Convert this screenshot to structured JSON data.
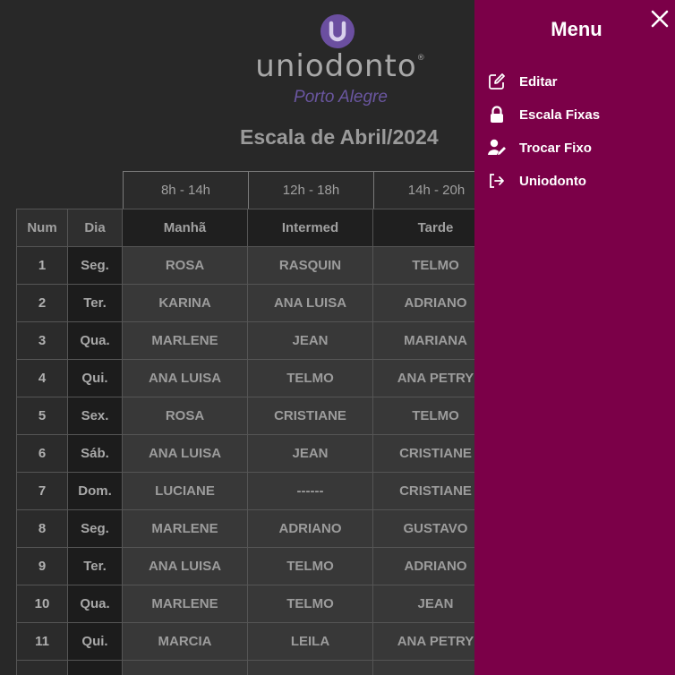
{
  "logo": {
    "wordmark": "uniodonto",
    "registered": "®",
    "subtitle": "Porto Alegre"
  },
  "title": "Escala de Abril/2024",
  "table": {
    "time_slots": [
      "8h - 14h",
      "12h - 18h",
      "14h - 20h"
    ],
    "headers": [
      "Num",
      "Dia",
      "Manhã",
      "Intermed",
      "Tarde"
    ],
    "rows": [
      {
        "num": "1",
        "dia": "Seg.",
        "manha": "ROSA",
        "intermed": "RASQUIN",
        "tarde": "TELMO"
      },
      {
        "num": "2",
        "dia": "Ter.",
        "manha": "KARINA",
        "intermed": "ANA LUISA",
        "tarde": "ADRIANO"
      },
      {
        "num": "3",
        "dia": "Qua.",
        "manha": "MARLENE",
        "intermed": "JEAN",
        "tarde": "MARIANA"
      },
      {
        "num": "4",
        "dia": "Qui.",
        "manha": "ANA LUISA",
        "intermed": "TELMO",
        "tarde": "ANA PETRY"
      },
      {
        "num": "5",
        "dia": "Sex.",
        "manha": "ROSA",
        "intermed": "CRISTIANE",
        "tarde": "TELMO"
      },
      {
        "num": "6",
        "dia": "Sáb.",
        "manha": "ANA LUISA",
        "intermed": "JEAN",
        "tarde": "CRISTIANE"
      },
      {
        "num": "7",
        "dia": "Dom.",
        "manha": "LUCIANE",
        "intermed": "------",
        "tarde": "CRISTIANE"
      },
      {
        "num": "8",
        "dia": "Seg.",
        "manha": "MARLENE",
        "intermed": "ADRIANO",
        "tarde": "GUSTAVO"
      },
      {
        "num": "9",
        "dia": "Ter.",
        "manha": "ANA LUISA",
        "intermed": "TELMO",
        "tarde": "ADRIANO"
      },
      {
        "num": "10",
        "dia": "Qua.",
        "manha": "MARLENE",
        "intermed": "TELMO",
        "tarde": "JEAN"
      },
      {
        "num": "11",
        "dia": "Qui.",
        "manha": "MARCIA",
        "intermed": "LEILA",
        "tarde": "ANA PETRY"
      },
      {
        "num": "",
        "dia": "",
        "manha": "",
        "intermed": "",
        "tarde": ""
      }
    ]
  },
  "menu": {
    "title": "Menu",
    "close_icon": "close-icon",
    "items": [
      {
        "label": "Editar",
        "icon": "edit-icon"
      },
      {
        "label": "Escala Fixas",
        "icon": "lock-icon"
      },
      {
        "label": "Trocar Fixo",
        "icon": "user-edit-icon"
      },
      {
        "label": "Uniodonto",
        "icon": "logout-icon"
      }
    ]
  },
  "colors": {
    "background": "#282828",
    "menu": "#7b0048",
    "brand": "#6b4fa0"
  }
}
